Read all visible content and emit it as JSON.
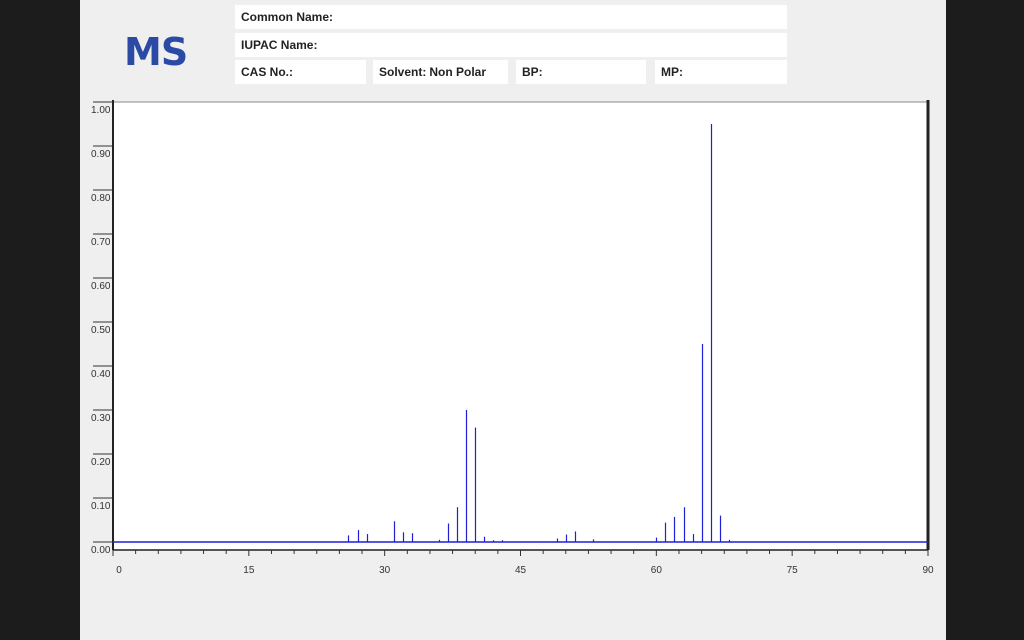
{
  "header": {
    "logo": "MS",
    "common_name_label": "Common Name:",
    "common_name_value": "",
    "iupac_name_label": "IUPAC Name:",
    "iupac_name_value": "",
    "cas_label": "CAS No.:",
    "cas_value": "",
    "solvent_label": "Solvent:",
    "solvent_value": "Non Polar",
    "bp_label": "BP:",
    "bp_value": "",
    "mp_label": "MP:",
    "mp_value": ""
  },
  "colors": {
    "line": "#1f1fd6",
    "logo": "#2b4aa6",
    "background": "#efefef",
    "plot": "#ffffff"
  },
  "chart_data": {
    "type": "bar",
    "title": "",
    "xlabel": "",
    "ylabel": "",
    "xlim": [
      0,
      90
    ],
    "ylim": [
      0,
      1.0
    ],
    "x_ticks": [
      "0",
      "15",
      "30",
      "45",
      "60",
      "75",
      "90"
    ],
    "y_ticks": [
      "0.00",
      "0.10",
      "0.20",
      "0.30",
      "0.40",
      "0.50",
      "0.60",
      "0.70",
      "0.80",
      "0.90",
      "1.00"
    ],
    "grid": false,
    "peaks": [
      {
        "mz": 26,
        "intensity": 0.015
      },
      {
        "mz": 27,
        "intensity": 0.027
      },
      {
        "mz": 28,
        "intensity": 0.018
      },
      {
        "mz": 31,
        "intensity": 0.047
      },
      {
        "mz": 32,
        "intensity": 0.022
      },
      {
        "mz": 33,
        "intensity": 0.02
      },
      {
        "mz": 36,
        "intensity": 0.005
      },
      {
        "mz": 37,
        "intensity": 0.042
      },
      {
        "mz": 38,
        "intensity": 0.079
      },
      {
        "mz": 39,
        "intensity": 0.3
      },
      {
        "mz": 40,
        "intensity": 0.26
      },
      {
        "mz": 41,
        "intensity": 0.012
      },
      {
        "mz": 42,
        "intensity": 0.004
      },
      {
        "mz": 43,
        "intensity": 0.004
      },
      {
        "mz": 49,
        "intensity": 0.008
      },
      {
        "mz": 50,
        "intensity": 0.017
      },
      {
        "mz": 51,
        "intensity": 0.024
      },
      {
        "mz": 53,
        "intensity": 0.006
      },
      {
        "mz": 60,
        "intensity": 0.01
      },
      {
        "mz": 61,
        "intensity": 0.044
      },
      {
        "mz": 62,
        "intensity": 0.057
      },
      {
        "mz": 63,
        "intensity": 0.079
      },
      {
        "mz": 64,
        "intensity": 0.018
      },
      {
        "mz": 65,
        "intensity": 0.45
      },
      {
        "mz": 66,
        "intensity": 0.95
      },
      {
        "mz": 67,
        "intensity": 0.06
      },
      {
        "mz": 68,
        "intensity": 0.005
      }
    ]
  }
}
